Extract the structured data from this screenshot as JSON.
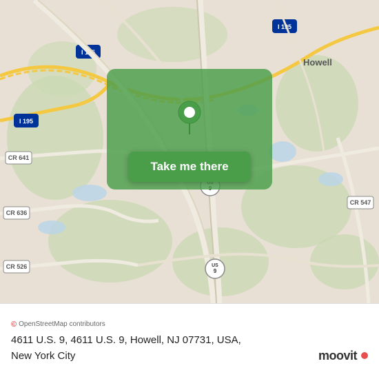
{
  "map": {
    "alt": "Map of Howell, NJ area",
    "overlay_color": "#4a9e4a",
    "pin_color": "#ffffff"
  },
  "button": {
    "label": "Take me there",
    "bg_color": "#4a9e4a"
  },
  "attribution": {
    "prefix": "©",
    "text": "OpenStreetMap contributors"
  },
  "address": {
    "line1": "4611 U.S. 9, 4611 U.S. 9, Howell, NJ 07731, USA,",
    "line2": "New York City"
  },
  "brand": {
    "name": "moovit"
  },
  "road_labels": [
    {
      "id": "i195-top-left",
      "text": "I 195"
    },
    {
      "id": "i195-top-right",
      "text": "I 195"
    },
    {
      "id": "i195-left",
      "text": "I 195"
    },
    {
      "id": "cr641",
      "text": "CR 641"
    },
    {
      "id": "cr636",
      "text": "CR 636"
    },
    {
      "id": "cr526",
      "text": "CR 526"
    },
    {
      "id": "cr547",
      "text": "CR 547"
    },
    {
      "id": "us9-top",
      "text": "US 9"
    },
    {
      "id": "us9-bottom",
      "text": "US 9"
    },
    {
      "id": "howell",
      "text": "Howell"
    }
  ]
}
